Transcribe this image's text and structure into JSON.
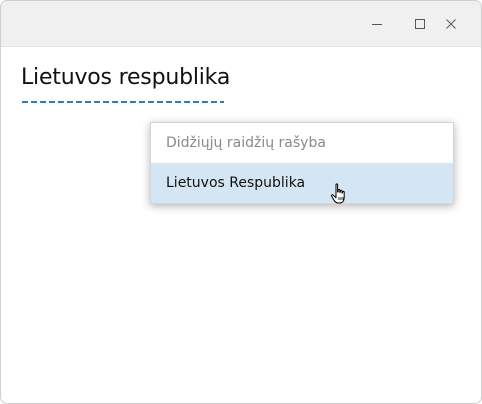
{
  "window": {
    "controls": {
      "minimize_icon": "minimize-icon",
      "maximize_icon": "maximize-icon",
      "close_icon": "close-icon"
    }
  },
  "document": {
    "text": "Lietuvos respublika"
  },
  "context_menu": {
    "header": "Didžiųjų raidžių rašyba",
    "items": [
      {
        "label": "Lietuvos Respublika",
        "highlighted": true
      }
    ]
  },
  "colors": {
    "spelling_underline": "#2b7fbf",
    "highlight": "#d4e6f3"
  },
  "cursor": "hand-pointer-icon"
}
